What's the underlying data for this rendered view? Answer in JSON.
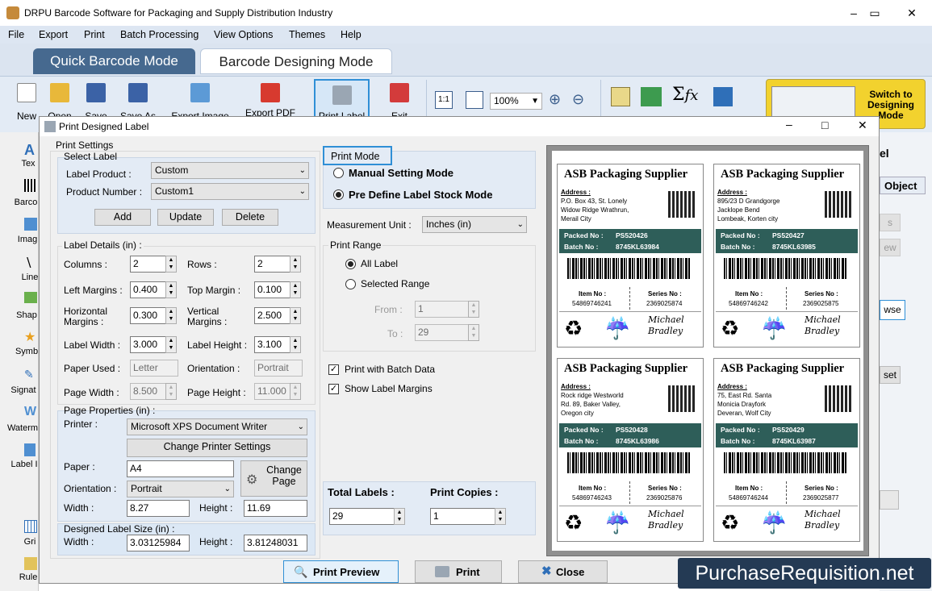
{
  "window": {
    "title": "DRPU Barcode Software for Packaging and Supply Distribution Industry"
  },
  "menu": [
    "File",
    "Export",
    "Print",
    "Batch Processing",
    "View Options",
    "Themes",
    "Help"
  ],
  "modes": {
    "quick": "Quick Barcode Mode",
    "designing": "Barcode Designing Mode"
  },
  "toolbar": {
    "new": "New",
    "open": "Open",
    "save": "Save",
    "save_as": "Save As",
    "export_image": "Export Image",
    "export_pdf": "Export PDF",
    "print_label": "Print Label",
    "exit": "Exit",
    "zoom": "100%",
    "switch": "Switch to Designing Mode"
  },
  "left_panel": [
    "Tex",
    "Barco",
    "Imag",
    "Line",
    "Shap",
    "Symb",
    "Signat",
    "Waterm",
    "Label I",
    "Gri",
    "Rule"
  ],
  "right_strip": {
    "tab_fragment": "el",
    "object_label": "Object",
    "btn1": "s",
    "btn2": "ew",
    "btn3": "wse",
    "btn4": "set"
  },
  "dialog": {
    "title": "Print Designed Label",
    "print_settings": "Print Settings",
    "select_label": {
      "legend": "Select Label",
      "label_product_label": "Label Product :",
      "label_product_value": "Custom",
      "product_number_label": "Product Number :",
      "product_number_value": "Custom1",
      "add": "Add",
      "update": "Update",
      "delete": "Delete"
    },
    "label_details": {
      "legend": "Label Details (in) :",
      "columns_label": "Columns :",
      "columns": "2",
      "rows_label": "Rows :",
      "rows": "2",
      "left_margins_label": "Left Margins :",
      "left_margins": "0.400",
      "top_margin_label": "Top Margin :",
      "top_margin": "0.100",
      "horizontal_margins_label": "Horizontal Margins :",
      "horizontal_margins": "0.300",
      "vertical_margins_label": "Vertical Margins :",
      "vertical_margins": "2.500",
      "label_width_label": "Label Width :",
      "label_width": "3.000",
      "label_height_label": "Label Height :",
      "label_height": "3.100",
      "paper_used_label": "Paper Used :",
      "paper_used": "Letter",
      "orientation_label": "Orientation :",
      "orientation": "Portrait",
      "page_width_label": "Page Width :",
      "page_width": "8.500",
      "page_height_label": "Page Height :",
      "page_height": "11.000"
    },
    "page_properties": {
      "legend": "Page Properties (in) :",
      "printer_label": "Printer :",
      "printer": "Microsoft XPS Document Writer",
      "change_printer": "Change Printer Settings",
      "paper_label": "Paper :",
      "paper": "A4",
      "orientation_label": "Orientation :",
      "orientation": "Portrait",
      "change_page": "Change Page",
      "width_label": "Width :",
      "width": "8.27",
      "height_label": "Height :",
      "height": "11.69"
    },
    "designed_size": {
      "legend": "Designed Label Size (in) :",
      "width_label": "Width :",
      "width": "3.03125984",
      "height_label": "Height :",
      "height": "3.81248031"
    },
    "print_mode": {
      "legend": "Print Mode",
      "manual": "Manual Setting Mode",
      "predefine": "Pre Define Label Stock Mode"
    },
    "measurement": {
      "label": "Measurement Unit :",
      "value": "Inches (in)"
    },
    "print_range": {
      "legend": "Print Range",
      "all": "All Label",
      "selected": "Selected Range",
      "from_label": "From :",
      "from": "1",
      "to_label": "To :",
      "to": "29"
    },
    "batch": "Print with Batch Data",
    "show_margins": "Show Label Margins",
    "total_labels_label": "Total Labels :",
    "total_labels": "29",
    "print_copies_label": "Print Copies :",
    "print_copies": "1",
    "buttons": {
      "preview": "Print Preview",
      "print": "Print",
      "close": "Close"
    }
  },
  "labels": [
    {
      "title": "ASB Packaging Supplier",
      "address_label": "Address :",
      "address": [
        "P.O. Box 43, St. Lonely",
        "Widow Ridge Wrathrun,",
        "Merail City"
      ],
      "packed_label": "Packed No :",
      "packed": "PS520426",
      "batch_label": "Batch No :",
      "batch": "8745KL63984",
      "item_label": "Item No :",
      "item": "54869746241",
      "series_label": "Series No :",
      "series": "2369025874",
      "signature": "Michael Bradley"
    },
    {
      "title": "ASB Packaging Supplier",
      "address_label": "Address :",
      "address": [
        "895/23 D Grandgorge",
        "Jacklope Bend",
        "Lombeak, Korten city"
      ],
      "packed_label": "Packed No :",
      "packed": "PS520427",
      "batch_label": "Batch No :",
      "batch": "8745KL63985",
      "item_label": "Item No :",
      "item": "54869746242",
      "series_label": "Series No :",
      "series": "2369025875",
      "signature": "Michael Bradley"
    },
    {
      "title": "ASB Packaging Supplier",
      "address_label": "Address :",
      "address": [
        "Rock ridge Westworld",
        "Rd. 89, Baker Valley,",
        "Oregon city"
      ],
      "packed_label": "Packed No :",
      "packed": "PS520428",
      "batch_label": "Batch No :",
      "batch": "8745KL63986",
      "item_label": "Item No :",
      "item": "54869746243",
      "series_label": "Series No :",
      "series": "2369025876",
      "signature": "Michael Bradley"
    },
    {
      "title": "ASB Packaging Supplier",
      "address_label": "Address :",
      "address": [
        "75, East Rd. Santa",
        "Monicia Drayfork",
        "Deveran, Wolf City"
      ],
      "packed_label": "Packed No :",
      "packed": "PS520429",
      "batch_label": "Batch No :",
      "batch": "8745KL63987",
      "item_label": "Item No :",
      "item": "54869746244",
      "series_label": "Series No :",
      "series": "2369025877",
      "signature": "Michael Bradley"
    }
  ],
  "watermark": "PurchaseRequisition.net",
  "colors": {
    "accent": "#2e5e59",
    "menu_bg": "#dde6f2",
    "toolbar_bg": "#e3ebf5",
    "active_tab": "#46698f"
  }
}
